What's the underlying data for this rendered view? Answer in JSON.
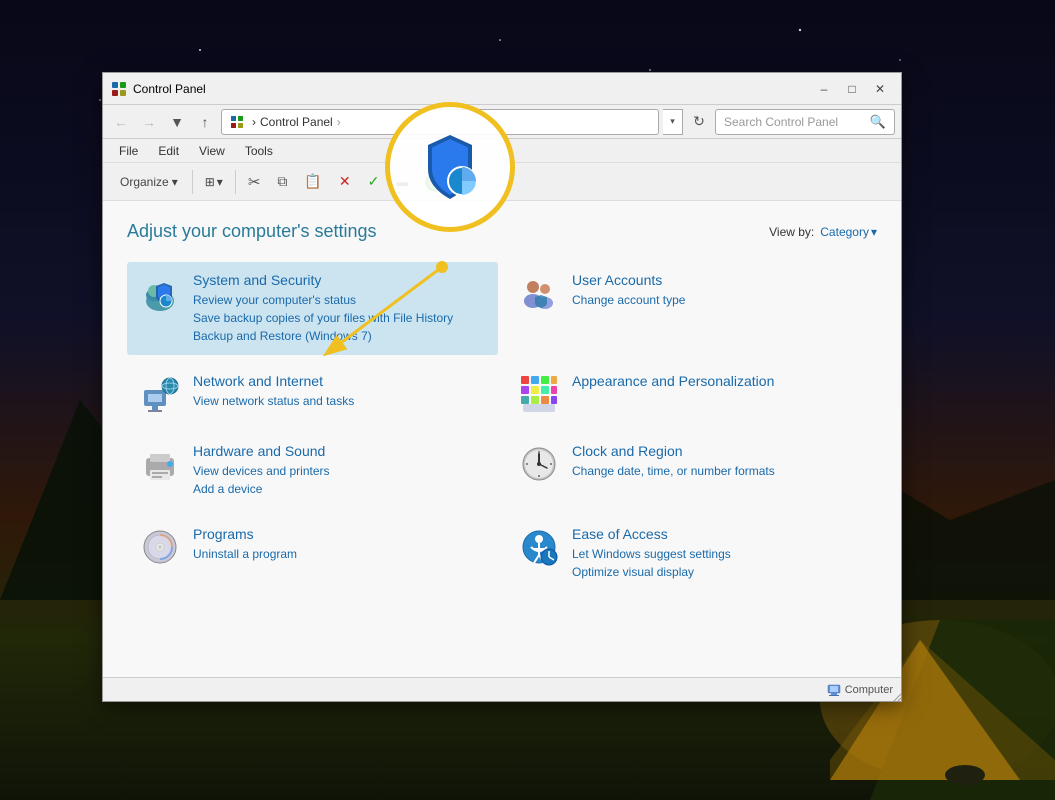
{
  "background": {
    "gradient_desc": "dark night sky with mountains"
  },
  "window": {
    "title": "Control Panel",
    "title_bar": {
      "text": "Control Panel",
      "minimize_label": "–",
      "maximize_label": "□",
      "close_label": "✕"
    },
    "address_bar": {
      "path": "Control Panel",
      "path_prefix": "▶",
      "search_placeholder": "Search Control Panel",
      "search_icon": "🔍"
    },
    "menu": {
      "items": [
        "File",
        "Edit",
        "View",
        "Tools"
      ]
    },
    "toolbar": {
      "buttons": [
        "⬆",
        "✂",
        "📋",
        "📄",
        "✕",
        "✓",
        "▬",
        "🌐"
      ]
    },
    "content": {
      "heading": "Adjust your computer's settings",
      "view_by_label": "View by:",
      "view_by_value": "Category",
      "categories": [
        {
          "id": "system-security",
          "title": "System and Security",
          "highlighted": true,
          "icon": "shield",
          "links": [
            "Review your computer's status",
            "Save backup copies of your files with File History",
            "Backup and Restore (Windows 7)"
          ]
        },
        {
          "id": "user-accounts",
          "title": "User Accounts",
          "highlighted": false,
          "icon": "users",
          "links": [
            "Change account type"
          ]
        },
        {
          "id": "network-internet",
          "title": "Network and Internet",
          "highlighted": false,
          "icon": "network",
          "links": [
            "View network status and tasks"
          ]
        },
        {
          "id": "appearance",
          "title": "Appearance and Personalization",
          "highlighted": false,
          "icon": "appearance",
          "links": []
        },
        {
          "id": "hardware-sound",
          "title": "Hardware and Sound",
          "highlighted": false,
          "icon": "hardware",
          "links": [
            "View devices and printers",
            "Add a device"
          ]
        },
        {
          "id": "clock-region",
          "title": "Clock and Region",
          "highlighted": false,
          "icon": "clock",
          "links": [
            "Change date, time, or number formats"
          ]
        },
        {
          "id": "programs",
          "title": "Programs",
          "highlighted": false,
          "icon": "programs",
          "links": [
            "Uninstall a program"
          ]
        },
        {
          "id": "ease-access",
          "title": "Ease of Access",
          "highlighted": false,
          "icon": "ease",
          "links": [
            "Let Windows suggest settings",
            "Optimize visual display"
          ]
        }
      ]
    },
    "status_bar": {
      "text": "Computer",
      "icon": "computer"
    }
  },
  "callout": {
    "visible": true,
    "icon": "shield-blue"
  }
}
